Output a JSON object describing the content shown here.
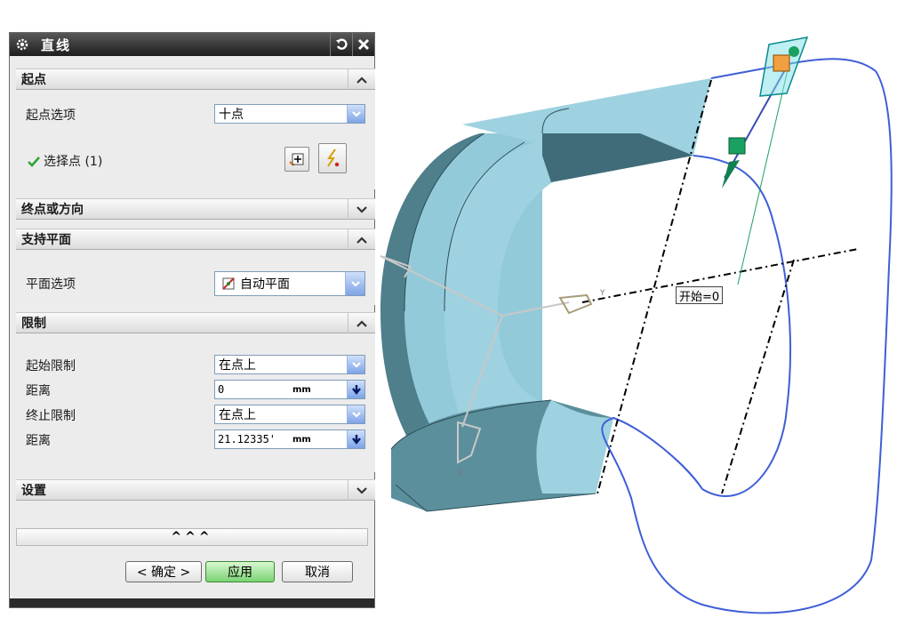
{
  "dialog": {
    "title": "直线",
    "sections": {
      "start": {
        "title": "起点",
        "option_label": "起点选项",
        "option_value": "十点",
        "select_point_label": "选择点 (1)"
      },
      "end": {
        "title": "终点或方向"
      },
      "support": {
        "title": "支持平面",
        "plane_label": "平面选项",
        "plane_value": "自动平面"
      },
      "limits": {
        "title": "限制",
        "start_limit_label": "起始限制",
        "start_limit_value": "在点上",
        "distance1_label": "距离",
        "distance1_value": "0",
        "distance1_unit": "mm",
        "end_limit_label": "终止限制",
        "end_limit_value": "在点上",
        "distance2_label": "距离",
        "distance2_value": "21.12335'",
        "distance2_unit": "mm"
      },
      "settings": {
        "title": "设置"
      }
    },
    "expander_label": "^^^",
    "buttons": {
      "ok": "< 确定 >",
      "apply": "应用",
      "cancel": "取消"
    }
  },
  "viewport": {
    "start_tag": "开始=0",
    "axis_y_label": "Y",
    "axis_x_label": "X"
  },
  "colors": {
    "face": "#8ec6d6",
    "face_dark": "#4e7f8b",
    "curve": "#3f5fd6",
    "handle": "#1aa060",
    "apply_green": "#7ad374"
  }
}
